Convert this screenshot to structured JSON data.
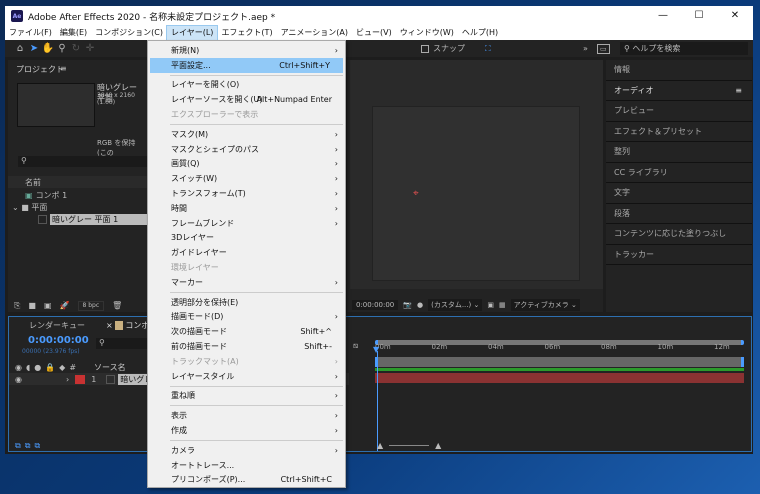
{
  "window": {
    "title": "Adobe After Effects 2020 - 名称未設定プロジェクト.aep *",
    "app_icon": "Ae",
    "min": "—",
    "max": "☐",
    "close": "✕"
  },
  "menubar": [
    "ファイル(F)",
    "編集(E)",
    "コンポジション(C)",
    "レイヤー(L)",
    "エフェクト(T)",
    "アニメーション(A)",
    "ビュー(V)",
    "ウィンドウ(W)",
    "ヘルプ(H)"
  ],
  "toolbar": {
    "snap": "スナップ",
    "help_search": "ヘルプを検索",
    "more": "»"
  },
  "project": {
    "title": "プロジェクト",
    "item_name": "暗いグレー 平面",
    "item_size": "3840 x 2160 (1.00)",
    "item_rgb": "RGB を保持 (この",
    "col_name": "名前",
    "items": [
      "コンポ 1",
      "平面",
      "暗いグレー 平面 1"
    ],
    "bpc": "8 bpc"
  },
  "viewer": {
    "timecode": "0:00:00:00",
    "resolution": "(カスタム...)",
    "camera": "アクティブカメラ"
  },
  "right_panel": [
    "情報",
    "オーディオ",
    "プレビュー",
    "エフェクト＆プリセット",
    "整列",
    "CC ライブラリ",
    "文字",
    "段落",
    "コンテンツに応じた塗りつぶし",
    "トラッカー"
  ],
  "timeline": {
    "tab_render": "レンダーキュー",
    "tab_comp": "コンポ 1",
    "timecode": "0:00:00:00",
    "frames": "00000 (23.976 fps)",
    "col_source": "ソース名",
    "layer_num": "1",
    "layer_name": "暗いグレー",
    "ticks": [
      "00m",
      "02m",
      "04m",
      "06m",
      "08m",
      "10m",
      "12m"
    ],
    "layer_color": "#c83232",
    "bar_color": "#8a3232"
  },
  "menu": [
    {
      "label": "新規(N)",
      "sub": true
    },
    {
      "label": "平面設定...",
      "shortcut": "Ctrl+Shift+Y",
      "highlight": true
    },
    {
      "sep": true
    },
    {
      "label": "レイヤーを開く(O)"
    },
    {
      "label": "レイヤーソースを開く(U)",
      "shortcut": "Alt+Numpad Enter"
    },
    {
      "label": "エクスプローラーで表示",
      "disabled": true
    },
    {
      "sep": true
    },
    {
      "label": "マスク(M)",
      "sub": true
    },
    {
      "label": "マスクとシェイプのパス",
      "sub": true
    },
    {
      "label": "画質(Q)",
      "sub": true
    },
    {
      "label": "スイッチ(W)",
      "sub": true
    },
    {
      "label": "トランスフォーム(T)",
      "sub": true
    },
    {
      "label": "時間",
      "sub": true
    },
    {
      "label": "フレームブレンド",
      "sub": true
    },
    {
      "label": "3Dレイヤー"
    },
    {
      "label": "ガイドレイヤー"
    },
    {
      "label": "環境レイヤー",
      "disabled": true
    },
    {
      "label": "マーカー",
      "sub": true
    },
    {
      "sep": true
    },
    {
      "label": "透明部分を保持(E)"
    },
    {
      "label": "描画モード(D)",
      "sub": true
    },
    {
      "label": "次の描画モード",
      "shortcut": "Shift+^"
    },
    {
      "label": "前の描画モード",
      "shortcut": "Shift+-"
    },
    {
      "label": "トラックマット(A)",
      "sub": true,
      "disabled": true
    },
    {
      "label": "レイヤースタイル",
      "sub": true
    },
    {
      "sep": true
    },
    {
      "label": "重ね順",
      "sub": true
    },
    {
      "sep": true
    },
    {
      "label": "表示",
      "sub": true
    },
    {
      "label": "作成",
      "sub": true
    },
    {
      "sep": true
    },
    {
      "label": "カメラ",
      "sub": true
    },
    {
      "label": "オートトレース..."
    },
    {
      "label": "プリコンポーズ(P)...",
      "shortcut": "Ctrl+Shift+C"
    }
  ]
}
